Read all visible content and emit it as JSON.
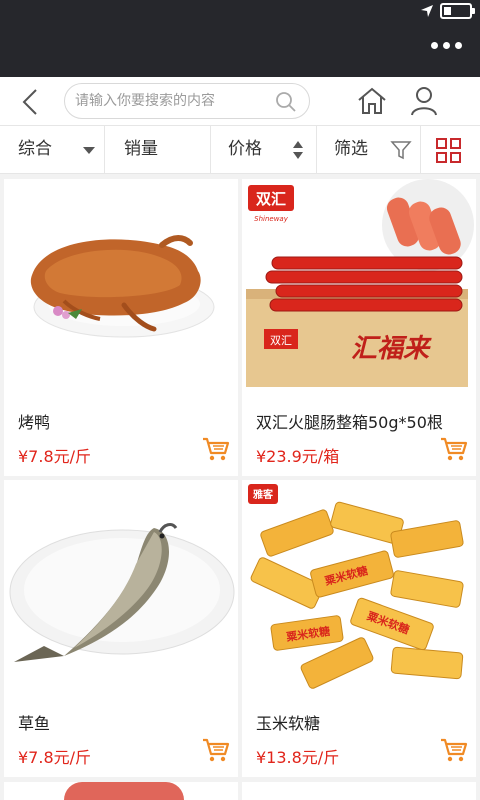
{
  "search": {
    "placeholder": "请输入你要搜索的内容"
  },
  "filters": {
    "comprehensive": "综合",
    "sales": "销量",
    "price": "价格",
    "filter": "筛选"
  },
  "products": [
    {
      "name": "烤鸭",
      "price": "¥7.8元/斤"
    },
    {
      "name": "双汇火腿肠整箱50g*50根",
      "price": "¥23.9元/箱",
      "brand": "双汇",
      "brand_en": "Shineway",
      "box_brand": "双汇",
      "box_product": "汇福来"
    },
    {
      "name": "草鱼",
      "price": "¥7.8元/斤"
    },
    {
      "name": "玉米软糖",
      "price": "¥13.8元/斤",
      "brand": "雅客",
      "wrapper_text": "粟米软糖"
    }
  ],
  "colors": {
    "accent": "#e1251b",
    "grid_icon": "#c8292c",
    "cart_icon": "#f08a24",
    "status_bar": "#26272c"
  }
}
